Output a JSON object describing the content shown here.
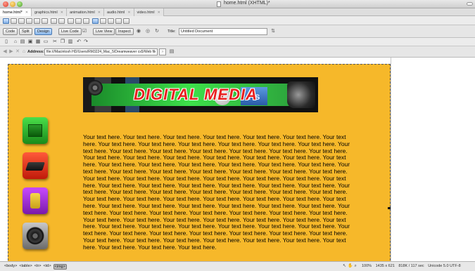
{
  "window": {
    "title": "home.html (XHTML)*"
  },
  "tabs": [
    {
      "label": "home.html*",
      "active": true
    },
    {
      "label": "graphics.html",
      "active": false
    },
    {
      "label": "animation.html",
      "active": false
    },
    {
      "label": "audio.html",
      "active": false
    },
    {
      "label": "video.html",
      "active": false
    }
  ],
  "toolbar": {
    "code": "Code",
    "split": "Split",
    "design": "Design",
    "live_code": "Live Code",
    "live_view": "Live View",
    "inspect": "Inspect",
    "title_label": "Title:",
    "title_value": "Untitled Document"
  },
  "address": {
    "label": "Address:",
    "value": "file:///Macintosh HD/Users/RM3224_Mac_5/Dreamweaver cs5/Web files/ho"
  },
  "page": {
    "background": "#f6b82a",
    "banner": {
      "text": "DIGITAL MEDIA",
      "logo_f": "f",
      "logo_ps": "Ps"
    },
    "body_text": "Your text here. Your text here. Your text here. Your text here. Your text here. Your text here. Your text here. Your text here. Your text here. Your text here. Your text here. Your text here. Your text here. Your text here. Your text here. Your text here. Your text here. Your text here. Your text here. Your text here. Your text here. Your text here. Your text here. Your text here. Your text here. Your text here. Your text here. Your text here. Your text here. Your text here. Your text here. Your text here. Your text here. Your text here. Your text here. Your text here. Your text here. Your text here. Your text here. Your text here. Your text here. Your text here. Your text here. Your text here. Your text here. Your text here. Your text here. Your text here. Your text here. Your text here. Your text here. Your text here. Your text here. Your text here. Your text here. Your text here. Your text here. Your text here. Your text here. Your text here. Your text here. Your text here. Your text here. Your text here. Your text here. Your text here. Your text here. Your text here. Your text here. Your text here. Your text here. Your text here. Your text here. Your text here. Your text here. Your text here. Your text here. Your text here. Your text here. Your text here. Your text here. Your text here. Your text here. Your text here. Your text here. Your text here. Your text here. Your text here. Your text here. Your text here. Your text here. Your text here. Your text here. Your text here. Your text here. Your text here. Your text here. Your text here. Your text here. Your text here. Your text here. Your text here. Your text here. Your text here. Your text here. Your text here. Your text here. Your text here. Your text here. Your text here."
  },
  "status": {
    "tags": [
      "<body>",
      "<table>",
      "<tr>",
      "<td>",
      "<img>"
    ],
    "zoom": "100%",
    "size": "1435 x 621",
    "file_info": "818K / 117 sec",
    "encoding": "Unicode 5.0 UTF-8"
  },
  "icons": {
    "nav": [
      "graphics-icon",
      "animation-icon",
      "audio-icon",
      "video-icon"
    ]
  }
}
